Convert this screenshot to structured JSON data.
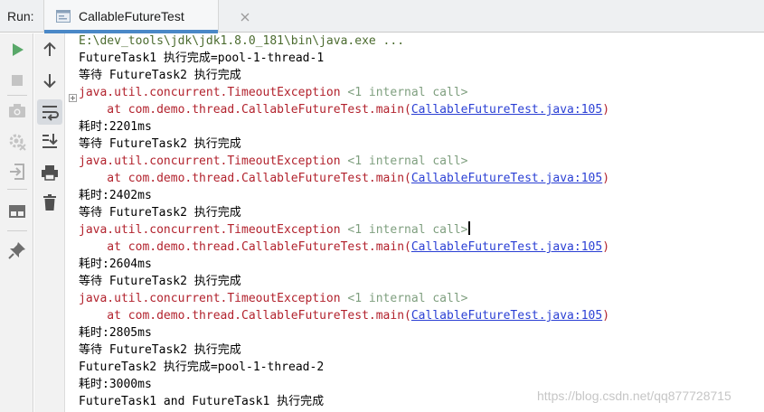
{
  "header": {
    "run_label": "Run:",
    "tab_title": "CallableFutureTest"
  },
  "toolbar_left": [
    {
      "icon": "run-icon",
      "color": "#59a869"
    },
    {
      "icon": "stop-icon",
      "color": "#c4c4c4"
    },
    {
      "icon": "camera-icon",
      "color": "#c4c4c4"
    },
    {
      "icon": "settings-icon",
      "color": "#c4c4c4"
    },
    {
      "icon": "exit-icon",
      "color": "#b0b0b0"
    },
    {
      "icon": "layout-icon",
      "color": "#6e6e6e"
    },
    {
      "icon": "pin-icon",
      "color": "#6e6e6e"
    }
  ],
  "toolbar_right": [
    {
      "icon": "arrow-up-icon"
    },
    {
      "icon": "arrow-down-icon"
    },
    {
      "icon": "soft-wrap-icon",
      "active": true
    },
    {
      "icon": "scroll-to-end-icon"
    },
    {
      "icon": "print-icon"
    },
    {
      "icon": "trash-icon"
    }
  ],
  "console": {
    "command": "E:\\dev_tools\\jdk\\jdk1.8.0_181\\bin\\java.exe ...",
    "line_task1_done": "FutureTask1 执行完成=pool-1-thread-1",
    "wait_line": "等待 FutureTask2 执行完成",
    "exception": "java.util.concurrent.TimeoutException",
    "internal_call": "<1 internal call>",
    "at_prefix": "    at com.demo.thread.CallableFutureTest.main(",
    "at_link": "CallableFutureTest.java:105",
    "at_suffix": ")",
    "elapsed": [
      "耗时:2201ms",
      "耗时:2402ms",
      "耗时:2604ms",
      "耗时:2805ms",
      "耗时:3000ms"
    ],
    "line_task2_done": "FutureTask2 执行完成=pool-1-thread-2",
    "line_final": "FutureTask1 and FutureTask1 执行完成"
  },
  "watermark": "https://blog.csdn.net/qq877728715"
}
